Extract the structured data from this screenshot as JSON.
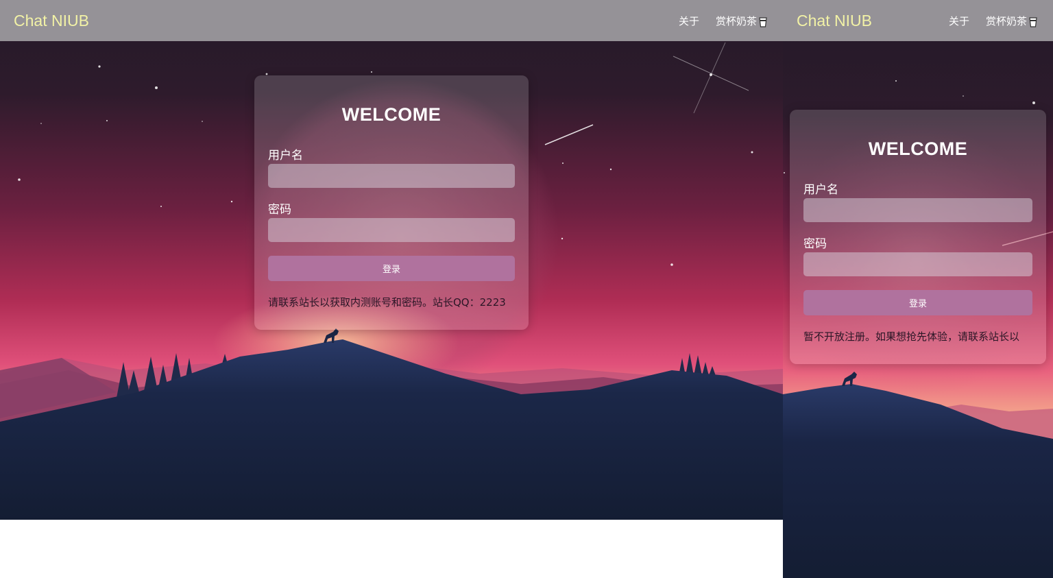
{
  "header": {
    "brand": "Chat NIUB",
    "nav": {
      "about_label": "关于",
      "tip_label": "赏杯奶茶",
      "tip_icon": "milk-tea-cup-icon"
    }
  },
  "login": {
    "title": "WELCOME",
    "username_label": "用户名",
    "username_value": "",
    "password_label": "密码",
    "password_value": "",
    "submit_label": "登录"
  },
  "desktop_view": {
    "notice": "请联系站长以获取内测账号和密码。站长QQ：2223"
  },
  "mobile_view": {
    "notice": "暂不开放注册。如果想抢先体验，请联系站长以"
  },
  "colors": {
    "topbar": "#959297",
    "brand": "#f2f2a6",
    "button": "#b0729e",
    "sky_top": "#261a2a",
    "sky_mid": "#a82c53",
    "mountain": "#15203a"
  }
}
